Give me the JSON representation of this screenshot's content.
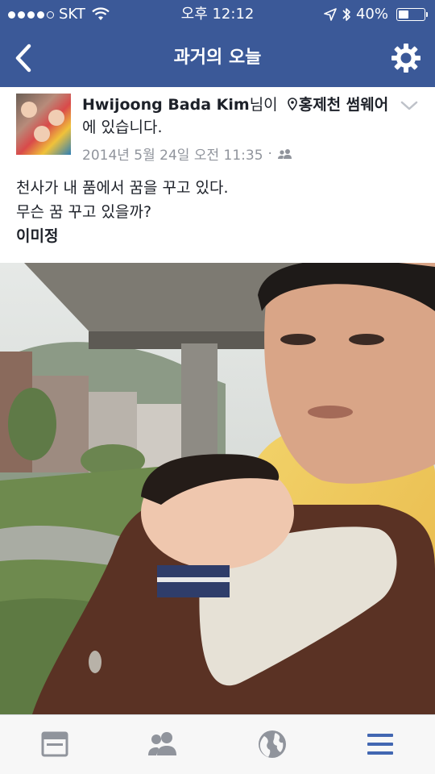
{
  "status": {
    "carrier": "SKT",
    "time": "오후 12:12",
    "battery": "40%",
    "battery_level": 0.4
  },
  "nav": {
    "title": "과거의 오늘",
    "back_icon": "chevron-left-icon",
    "settings_icon": "gear-icon"
  },
  "post": {
    "author": "Hwijoong Bada Kim",
    "suffix": "님이",
    "location": "홍제천 썸웨어",
    "location_suffix": "에 있습니다.",
    "timestamp": "2014년 5월 24일 오전 11:35",
    "separator": "·",
    "audience_icon": "friends-icon",
    "text_line1": "천사가 내 품에서 꿈을 꾸고 있다.",
    "text_line2": "무슨 꿈 꾸고 있을까?",
    "tagged": "이미정"
  },
  "tabbar": {
    "items": [
      "news-feed-icon",
      "friends-icon",
      "globe-icon",
      "menu-icon"
    ],
    "active": "menu-icon"
  },
  "colors": {
    "brand": "#3b5998",
    "active_tab": "#4267b2",
    "inactive_tab": "#90949c"
  }
}
